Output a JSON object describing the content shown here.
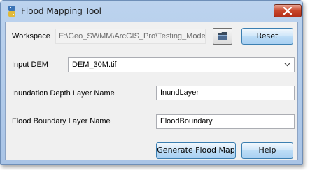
{
  "window": {
    "title": "Flood Mapping Tool",
    "accent_color": "#c8462b"
  },
  "workspace": {
    "label": "Workspace",
    "value": "E:\\Geo_SWMM\\ArcGIS_Pro\\Testing_Models\\"
  },
  "buttons": {
    "reset": "Reset",
    "generate": "Generate Flood Map",
    "help": "Help"
  },
  "input_dem": {
    "label": "Input DEM",
    "selected": "DEM_30M.tif"
  },
  "inundation": {
    "label": "Inundation Depth Layer Name",
    "value": "InundLayer"
  },
  "boundary": {
    "label": "Flood Boundary Layer Name",
    "value": "FloodBoundary"
  },
  "icons": {
    "app": "python-script-icon",
    "close": "close-icon",
    "folder": "folder-browse-icon",
    "dropdown": "chevron-down-icon"
  }
}
